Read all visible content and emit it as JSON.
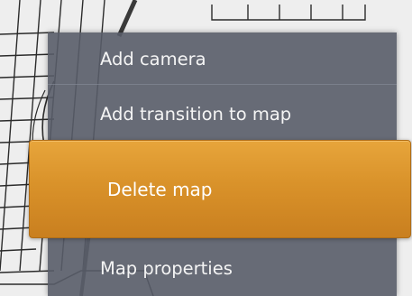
{
  "context_menu": {
    "items": [
      {
        "label": "Add camera"
      },
      {
        "label": "Add transition to map"
      },
      {
        "label": "Delete map",
        "highlighted": true
      },
      {
        "label": "Map properties"
      }
    ]
  },
  "colors": {
    "menu_background": "#585c68",
    "highlight": "#d9922a",
    "menu_text": "#f4f4f4"
  }
}
